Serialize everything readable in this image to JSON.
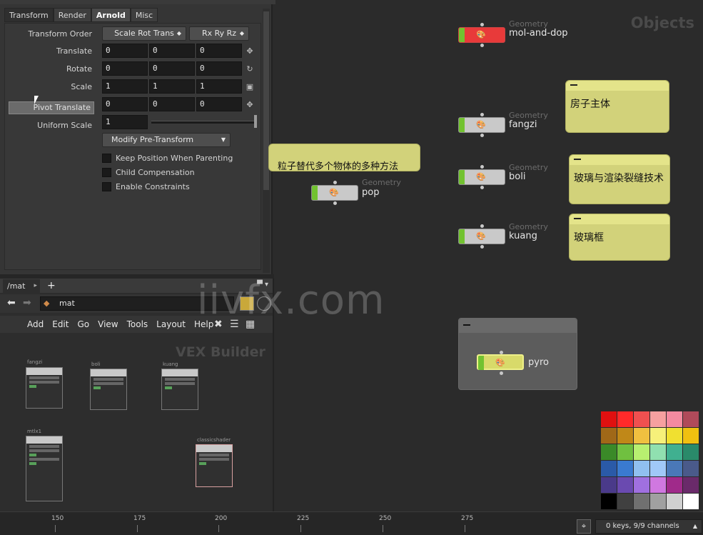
{
  "params": {
    "tabs": [
      {
        "label": "Transform"
      },
      {
        "label": "Render"
      },
      {
        "label": "Arnold"
      },
      {
        "label": "Misc"
      }
    ],
    "transform_order_label": "Transform Order",
    "transform_order_value": "Scale Rot Trans",
    "rotate_order_value": "Rx Ry Rz",
    "translate_label": "Translate",
    "translate": [
      "0",
      "0",
      "0"
    ],
    "rotate_label": "Rotate",
    "rotate": [
      "0",
      "0",
      "0"
    ],
    "scale_label": "Scale",
    "scale": [
      "1",
      "1",
      "1"
    ],
    "pivot_translate_label": "Pivot Translate",
    "pivot_translate": [
      "0",
      "0",
      "0"
    ],
    "uniform_scale_label": "Uniform Scale",
    "uniform_scale": "1",
    "modify_pre_transform": "Modify Pre-Transform",
    "keep_position": "Keep Position When Parenting",
    "child_compensation": "Child Compensation",
    "enable_constraints": "Enable Constraints"
  },
  "mat": {
    "tab_label": "/mat",
    "path": "mat",
    "menu": [
      "Add",
      "Edit",
      "Go",
      "View",
      "Tools",
      "Layout",
      "Help"
    ],
    "context_watermark": "VEX Builder",
    "nodes": [
      "fangzi",
      "boli",
      "kuang",
      "mtlx1",
      "classicshader"
    ]
  },
  "network": {
    "context_watermark": "Objects",
    "type_label": "Geometry",
    "nodes": [
      {
        "name": "mol-and-dop",
        "color": "#e83a3a"
      },
      {
        "name": "fangzi",
        "color": "#c9c9c9"
      },
      {
        "name": "boli",
        "color": "#c9c9c9"
      },
      {
        "name": "kuang",
        "color": "#c9c9c9"
      },
      {
        "name": "pop",
        "color": "#c9c9c9"
      },
      {
        "name": "pyro",
        "color": "#d8da6a"
      }
    ],
    "sticky_notes": [
      "房子主体",
      "粒子替代多个物体的多种方法",
      "玻璃与渲染裂缝技术",
      "玻璃框"
    ]
  },
  "palette": [
    "#e01010",
    "#ff2a2a",
    "#f05050",
    "#f6a0a0",
    "#f48aa0",
    "#b04a5a",
    "#a06818",
    "#c08818",
    "#f0c040",
    "#f6f07a",
    "#f0e030",
    "#f0c010",
    "#3a8a28",
    "#70c040",
    "#b8f070",
    "#90e0b0",
    "#40b090",
    "#2a8a6a",
    "#2a5aa8",
    "#3a7ad0",
    "#90c0f0",
    "#a0c8f8",
    "#4a78b8",
    "#4a5a8a",
    "#4a3a8a",
    "#6a4ab0",
    "#a070e0",
    "#d078e0",
    "#a02a8a",
    "#6a2a6a",
    "#000000",
    "#404040",
    "#707070",
    "#a0a0a0",
    "#d0d0d0",
    "#ffffff"
  ],
  "timeline": {
    "ticks": [
      "150",
      "175",
      "200",
      "225",
      "250",
      "275"
    ],
    "channels": "0 keys, 9/9 channels"
  },
  "watermark": "iivfx.com"
}
